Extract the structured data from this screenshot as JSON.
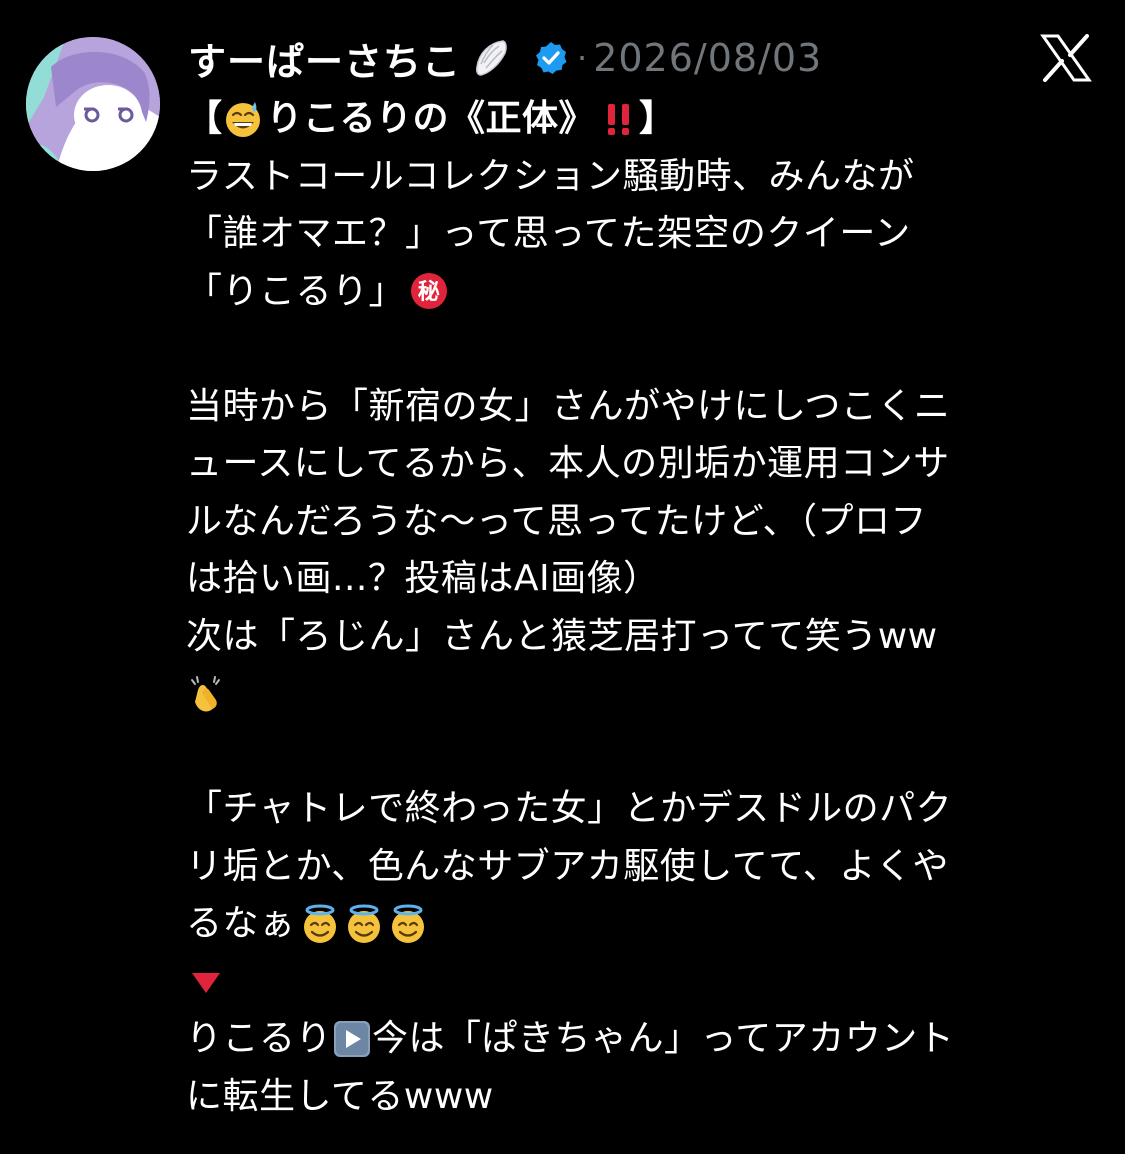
{
  "author": {
    "display_name": "すーぱーさちこ",
    "name_emoji": "wing-emoji",
    "verified_badge": "verified-badge-icon",
    "separator": "·",
    "timestamp": "2026/08/03"
  },
  "platform_logo": "x-logo-icon",
  "colors": {
    "background": "#000000",
    "text": "#ffffff",
    "muted": "#71767b",
    "verified": "#1d9bf0",
    "avatar": "#b8a4dc",
    "red_mark": "#e0243b"
  },
  "post": {
    "title_open": "【",
    "title_text": "りこるりの《正体》",
    "title_close": "】",
    "l1": "ラストコールコレクション騒動時、みんなが",
    "l2": "「誰オマエ？」って思ってた架空のクイーン",
    "l3": "「りこるり」",
    "l5": "当時から「新宿の女」さんがやけにしつこくニ",
    "l6": "ュースにしてるから、本人の別垢か運用コンサ",
    "l7": "ルなんだろうな〜って思ってたけど、（プロフ",
    "l8": "は拾い画...？投稿はAI画像）",
    "l9": "次は「ろじん」さんと猿芝居打ってて笑うww",
    "l12": "「チャトレで終わった女」とかデスドルのパク",
    "l13": "リ垢とか、色んなサブアカ駆使してて、よくや",
    "l14": "るなぁ",
    "l16a": "りこるり",
    "l16b": "今は「ぱきちゃん」ってアカウント",
    "l17": "に転生してるwww"
  }
}
